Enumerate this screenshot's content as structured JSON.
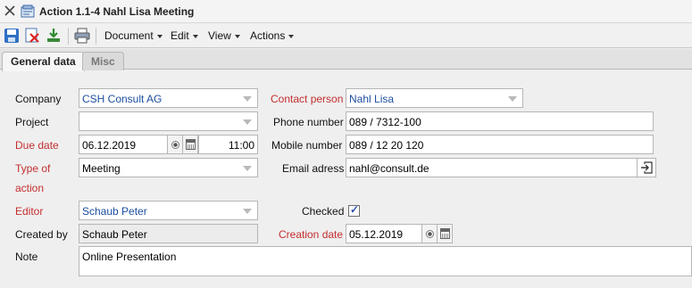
{
  "window": {
    "title": "Action 1.1-4 Nahl Lisa Meeting"
  },
  "toolbar": {
    "menus": [
      "Document",
      "Edit",
      "View",
      "Actions"
    ]
  },
  "tabs": [
    "General data",
    "Misc"
  ],
  "form": {
    "company_label": "Company",
    "company_value": "CSH Consult AG",
    "project_label": "Project",
    "project_value": "",
    "due_date_label": "Due date",
    "due_date_value": "06.12.2019",
    "due_time_value": "11:00",
    "type_label_line1": "Type of",
    "type_label_line2": "action",
    "type_value": "Meeting",
    "editor_label": "Editor",
    "editor_value": "Schaub Peter",
    "created_by_label": "Created by",
    "created_by_value": "Schaub Peter",
    "note_label": "Note",
    "note_value": "Online Presentation",
    "contact_label": "Contact person",
    "contact_value": "Nahl Lisa",
    "phone_label": "Phone number",
    "phone_value": "089 / 7312-100",
    "mobile_label": "Mobile number",
    "mobile_value": "089 / 12 20 120",
    "email_label": "Email adress",
    "email_value": "nahl@consult.de",
    "checked_label": "Checked",
    "checked_value": true,
    "creation_date_label": "Creation date",
    "creation_date_value": "05.12.2019"
  },
  "colors": {
    "required_label": "#c42f2f",
    "link_value": "#1c4fa0"
  }
}
